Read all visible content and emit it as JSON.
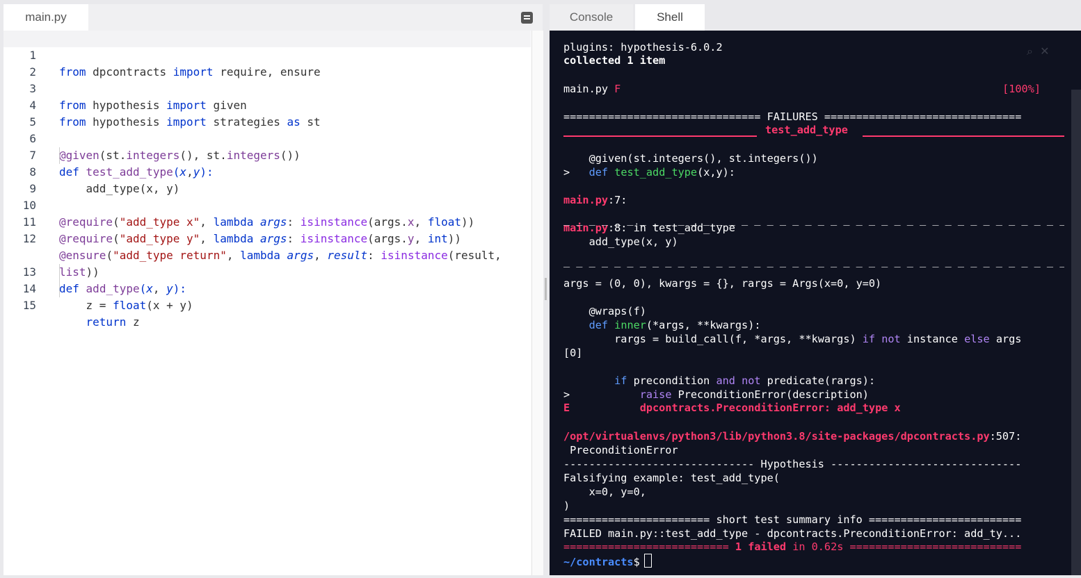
{
  "editor": {
    "tab_label": "main.py",
    "lines": [
      {
        "n": "1",
        "text": "from dpcontracts import require, ensure"
      },
      {
        "n": "2",
        "text": ""
      },
      {
        "n": "3",
        "text": "from hypothesis import given"
      },
      {
        "n": "4",
        "text": "from hypothesis import strategies as st"
      },
      {
        "n": "5",
        "text": ""
      },
      {
        "n": "6",
        "text": "@given(st.integers(), st.integers())"
      },
      {
        "n": "7",
        "text": "def test_add_type(x,y):"
      },
      {
        "n": "8",
        "text": "    add_type(x, y)"
      },
      {
        "n": "9",
        "text": ""
      },
      {
        "n": "10",
        "text": "@require(\"add_type x\", lambda args: isinstance(args.x, float))"
      },
      {
        "n": "11",
        "text": "@require(\"add_type y\", lambda args: isinstance(args.y, int))"
      },
      {
        "n": "12",
        "text": "@ensure(\"add_type return\", lambda args, result: isinstance(result,"
      },
      {
        "n": "",
        "text": "list))"
      },
      {
        "n": "13",
        "text": "def add_type(x, y):"
      },
      {
        "n": "14",
        "text": "    z = float(x + y)"
      },
      {
        "n": "15",
        "text": "    return z"
      }
    ]
  },
  "tabs": {
    "console": "Console",
    "shell": "Shell"
  },
  "terminal": {
    "plugins": "plugins: hypothesis-6.0.2",
    "collected": "collected 1 item",
    "file": "main.py",
    "file_status": "F",
    "progress": "[100%]",
    "failures_header": "=============================== FAILURES ===============================",
    "test_name": "test_add_type",
    "given_line": "    @given(st.integers(), st.integers())",
    "def_marker": ">",
    "def_kw": "def",
    "def_name": "test_add_type",
    "def_args": "(x,y):",
    "loc1_file": "main.py",
    "loc1_rest": ":7:",
    "dashes": "_ _ _ _ _ _ _ _ _ _ _ _ _ _ _ _ _ _ _ _ _ _ _ _ _ _ _ _ _ _ _ _ _ _ _ _ _ _ _ _ _ _ _ _ _ _ _ _ _ _ _ _ _ _ _ _ _ _ _ _ _ _ _ _ _ _ _ _ _ _ _ _",
    "loc2_file": "main.py",
    "loc2_rest": ":8: in test_add_type",
    "call_line": "    add_type(x, y)",
    "args_line": "args = (0, 0), kwargs = {}, rargs = Args(x=0, y=0)",
    "wraps_line": "    @wraps(f)",
    "inner_def": "def",
    "inner_name": "inner",
    "inner_args": "(*args, **kwargs):",
    "rargs_line_a": "        rargs = build_call(f, *args, **kwargs) ",
    "rargs_if": "if",
    "rargs_not": "not",
    "rargs_mid": " instance ",
    "rargs_else": "else",
    "rargs_end": " args",
    "rargs_wrap": "[0]",
    "if_kw": "if",
    "if_mid": " precondition ",
    "and_kw": "and",
    "not_kw": "not",
    "if_end": " predicate(rargs):",
    "raise_marker": ">",
    "raise_kw": "raise",
    "raise_rest": " PreconditionError(description)",
    "error_marker": "E",
    "error_text": "dpcontracts.PreconditionError: add_type x",
    "path": "/opt/virtualenvs/python3/lib/python3.8/site-packages/dpcontracts.py",
    "path_line": ":507:",
    "path_error": " PreconditionError",
    "hypothesis_header": "------------------------------ Hypothesis ------------------------------",
    "falsifying": "Falsifying example: test_add_type(",
    "falsifying_args": "    x=0, y=0,",
    "close_paren": ")",
    "summary_header": "======================= short test summary info ========================",
    "failed_line": "FAILED main.py::test_add_type - dpcontracts.PreconditionError: add_ty...",
    "result_left": "==========================",
    "result_failed": "1 failed",
    "result_in": "in 0.62s",
    "result_right": "===========================",
    "prompt_path": "~/contracts",
    "prompt_symbol": "$"
  }
}
